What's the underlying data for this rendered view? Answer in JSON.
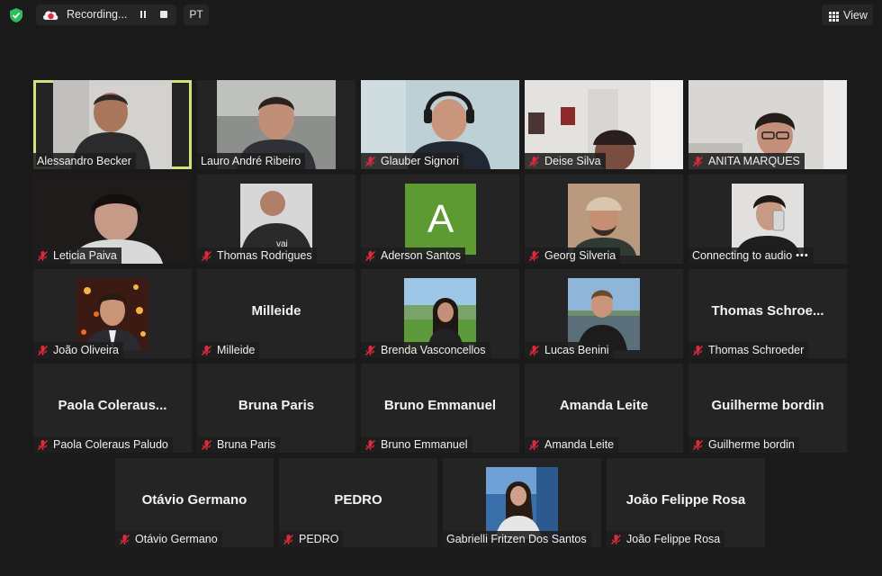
{
  "topbar": {
    "recording_label": "Recording...",
    "language": "PT",
    "view_label": "View"
  },
  "colors": {
    "active_speaker_border": "#d4e27a",
    "muted_mic": "#e0293b",
    "avatar_bg": "#5d9b32",
    "security_shield": "#2dbd5a"
  },
  "participants": [
    {
      "name": "Alessandro Becker",
      "muted": false,
      "active_speaker": true,
      "video": true
    },
    {
      "name": "Lauro André Ribeiro",
      "muted": false,
      "video": true
    },
    {
      "name": "Glauber Signori",
      "muted": true,
      "video": true
    },
    {
      "name": "Deise Silva",
      "muted": true,
      "video": true
    },
    {
      "name": "ANITA MARQUES",
      "muted": true,
      "video": true
    },
    {
      "name": "Leticia Paiva",
      "muted": true,
      "video": true
    },
    {
      "name": "Thomas Rodrigues",
      "muted": true,
      "video": true
    },
    {
      "name": "Aderson Santos",
      "muted": true,
      "video": false,
      "avatar_letter": "A"
    },
    {
      "name": "Georg Silveria",
      "muted": true,
      "video": true
    },
    {
      "name": "Connecting to audio",
      "muted": false,
      "video": true,
      "status_icon": "more-dots-icon"
    },
    {
      "name": "João Oliveira",
      "muted": true,
      "video": true
    },
    {
      "name": "Milleide",
      "display": "Milleide",
      "muted": true,
      "video": false
    },
    {
      "name": "Brenda Vasconcellos",
      "muted": true,
      "video": true
    },
    {
      "name": "Lucas Benini",
      "muted": true,
      "video": true
    },
    {
      "name": "Thomas Schroeder",
      "display": "Thomas  Schroe...",
      "muted": true,
      "video": false
    },
    {
      "name": "Paola Coleraus Paludo",
      "display": "Paola  Coleraus...",
      "muted": true,
      "video": false
    },
    {
      "name": "Bruna Paris",
      "display": "Bruna Paris",
      "muted": true,
      "video": false
    },
    {
      "name": "Bruno Emmanuel",
      "display": "Bruno Emmanuel",
      "muted": true,
      "video": false
    },
    {
      "name": "Amanda Leite",
      "display": "Amanda Leite",
      "muted": true,
      "video": false
    },
    {
      "name": "Guilherme bordin",
      "display": "Guilherme bordin",
      "muted": true,
      "video": false
    },
    {
      "name": "Otávio Germano",
      "display": "Otávio Germano",
      "muted": true,
      "video": false
    },
    {
      "name": "PEDRO",
      "display": "PEDRO",
      "muted": true,
      "video": false
    },
    {
      "name": "Gabrielli Fritzen Dos Santos",
      "muted": false,
      "video": true
    },
    {
      "name": "João Felippe Rosa",
      "display": "João Felippe Rosa",
      "muted": true,
      "video": false
    }
  ]
}
